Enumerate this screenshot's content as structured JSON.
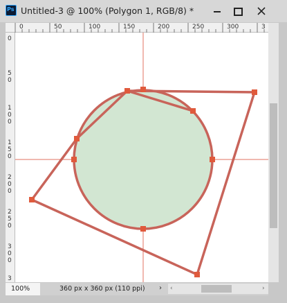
{
  "window": {
    "title": "Untitled-3 @ 100% (Polygon 1, RGB/8) *",
    "app_icon_text": "Ps",
    "min_label": "minimize",
    "max_label": "maximize",
    "close_label": "close"
  },
  "ruler_top": [
    "0",
    "50",
    "100",
    "150",
    "200",
    "250",
    "300",
    "3"
  ],
  "ruler_left": [
    "0",
    "5\n0",
    "1\n0\n0",
    "1\n5\n0",
    "2\n0\n0",
    "2\n5\n0",
    "3\n0\n0",
    "3"
  ],
  "status": {
    "zoom": "100%",
    "doc_info": "360 px x 360 px (110 ppi)",
    "arrow": "›"
  },
  "colors": {
    "stroke": "#c8645a",
    "fill": "#d2e6d2",
    "guide": "#e07060",
    "anchor": "#e05a3c"
  },
  "icons": [
    "ps-app-icon",
    "minimize-icon",
    "maximize-icon",
    "close-icon",
    "chevron-right-icon",
    "scroll-left-icon",
    "scroll-right-icon"
  ]
}
